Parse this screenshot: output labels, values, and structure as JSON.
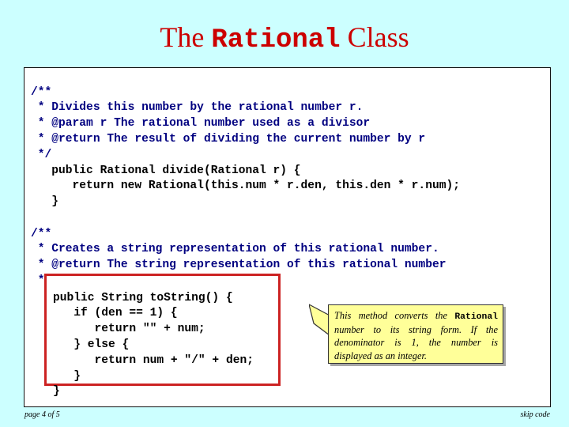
{
  "title": {
    "prefix": "The ",
    "mono": "Rational",
    "suffix": " Class",
    "color": "#CC0000"
  },
  "colors": {
    "background": "#CCFFFF",
    "panel": "#FFFFFF",
    "comment": "#000080",
    "code": "#000000",
    "highlight_border": "#CC2222",
    "callout_fill": "#FFFF99",
    "callout_border": "#333333"
  },
  "code": {
    "comment_block_1": "/**\n * Divides this number by the rational number r.\n * @param r The rational number used as a divisor\n * @return The result of dividing the current number by r\n */",
    "method_divide": "   public Rational divide(Rational r) {\n      return new Rational(this.num * r.den, this.den * r.num);\n   }",
    "comment_block_2": "/**\n * Creates a string representation of this rational number.\n * @return The string representation of this rational number\n */",
    "method_tostring": "public String toString() {\n   if (den == 1) {\n      return \"\" + num;\n   } else {\n      return num + \"/\" + den;\n   }\n}"
  },
  "callout": {
    "line1_a": "This method converts the ",
    "line1_mono": "Rational",
    "rest": " number to its string form.   If the denominator is 1, the number is displayed as an integer."
  },
  "footer": {
    "page": "page 4 of 5",
    "skip": "skip code"
  }
}
